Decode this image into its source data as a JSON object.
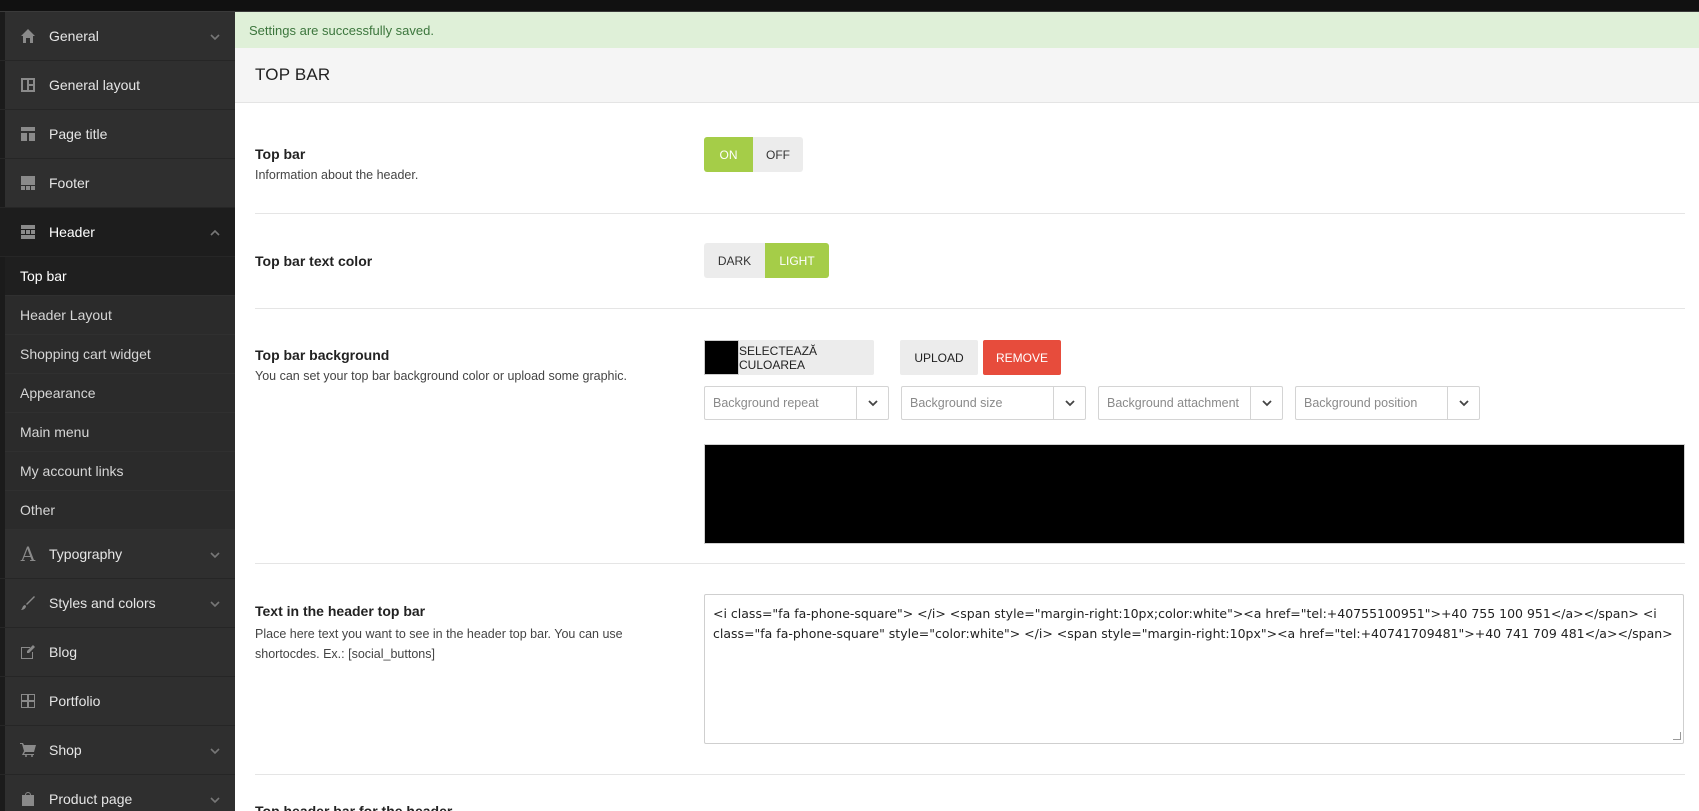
{
  "sidebar": {
    "items_top": [
      {
        "label": "General",
        "icon": "home-icon",
        "chevron": true
      },
      {
        "label": "General layout",
        "icon": "layout-icon",
        "chevron": false
      },
      {
        "label": "Page title",
        "icon": "page-title-icon",
        "chevron": false
      },
      {
        "label": "Footer",
        "icon": "footer-icon",
        "chevron": false
      },
      {
        "label": "Header",
        "icon": "header-icon",
        "chevron": true,
        "expanded": true
      }
    ],
    "sub_items": [
      "Top bar",
      "Header Layout",
      "Shopping cart widget",
      "Appearance",
      "Main menu",
      "My account links",
      "Other"
    ],
    "items_bottom": [
      {
        "label": "Typography",
        "icon": "typography-icon",
        "chevron": true
      },
      {
        "label": "Styles and colors",
        "icon": "brush-icon",
        "chevron": true
      },
      {
        "label": "Blog",
        "icon": "blog-icon",
        "chevron": false
      },
      {
        "label": "Portfolio",
        "icon": "portfolio-icon",
        "chevron": false
      },
      {
        "label": "Shop",
        "icon": "cart-icon",
        "chevron": true
      },
      {
        "label": "Product page",
        "icon": "product-icon",
        "chevron": true
      }
    ]
  },
  "notice": "Settings are successfully saved.",
  "page_title": "TOP BAR",
  "settings": {
    "top_bar": {
      "label": "Top bar",
      "desc": "Information about the header.",
      "on": "ON",
      "off": "OFF",
      "selected": "on"
    },
    "text_color": {
      "label": "Top bar text color",
      "dark": "DARK",
      "light": "LIGHT",
      "selected": "light"
    },
    "background": {
      "label": "Top bar background",
      "desc": "You can set your top bar background color or upload some graphic.",
      "color": "#000000",
      "select_color": "SELECTEAZĂ CULOAREA",
      "upload": "UPLOAD",
      "remove": "REMOVE",
      "repeat_placeholder": "Background repeat",
      "size_placeholder": "Background size",
      "attachment_placeholder": "Background attachment",
      "position_placeholder": "Background position"
    },
    "header_text": {
      "label": "Text in the header top bar",
      "desc": "Place here text you want to see in the header top bar. You can use shortocdes. Ex.: [social_buttons]",
      "value": "<i class=\"fa fa-phone-square\"> </i> <span style=\"margin-right:10px;color:white\"><a href=\"tel:+40755100951\">+40 755 100 951</a></span> <i class=\"fa fa-phone-square\" style=\"color:white\"> </i> <span style=\"margin-right:10px\"><a href=\"tel:+40741709481\">+40 741 709 481</a></span>"
    },
    "next_label": "Top header bar for the header"
  },
  "colors": {
    "accent_green": "#a5cd48",
    "remove_red": "#e74c3c",
    "notice_bg": "#dff0d8"
  }
}
